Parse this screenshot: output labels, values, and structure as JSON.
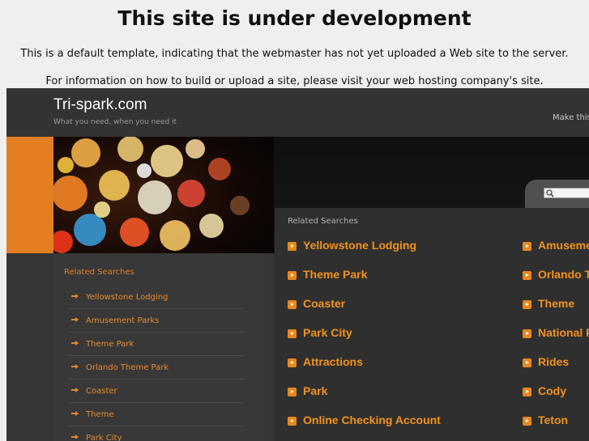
{
  "notice": {
    "title": "This site is under development",
    "line1": "This is a default template, indicating that the webmaster has not yet uploaded a Web site to the server.",
    "line2": "For information on how to build or upload a site, please visit your web hosting company's site."
  },
  "header": {
    "site_title": "Tri-spark.com",
    "tagline": "What you need, when you need it",
    "make_link": "Make this"
  },
  "left": {
    "heading": "Related Searches",
    "items": [
      "Yellowstone Lodging",
      "Amusement Parks",
      "Theme Park",
      "Orlando Theme Park",
      "Coaster",
      "Theme",
      "Park City"
    ]
  },
  "main": {
    "heading": "Related Searches",
    "col1": [
      "Yellowstone Lodging",
      "Theme Park",
      "Coaster",
      "Park City",
      "Attractions",
      "Park",
      "Online Checking Account"
    ],
    "col2": [
      "Amuseme",
      "Orlando T",
      "Theme",
      "National P",
      "Rides",
      "Cody",
      "Teton"
    ]
  },
  "colors": {
    "accent": "#e47e22",
    "link": "#f0921c",
    "background": "#363636"
  },
  "icons": {
    "search": "search-icon",
    "bullet": "arrow-right-icon"
  }
}
